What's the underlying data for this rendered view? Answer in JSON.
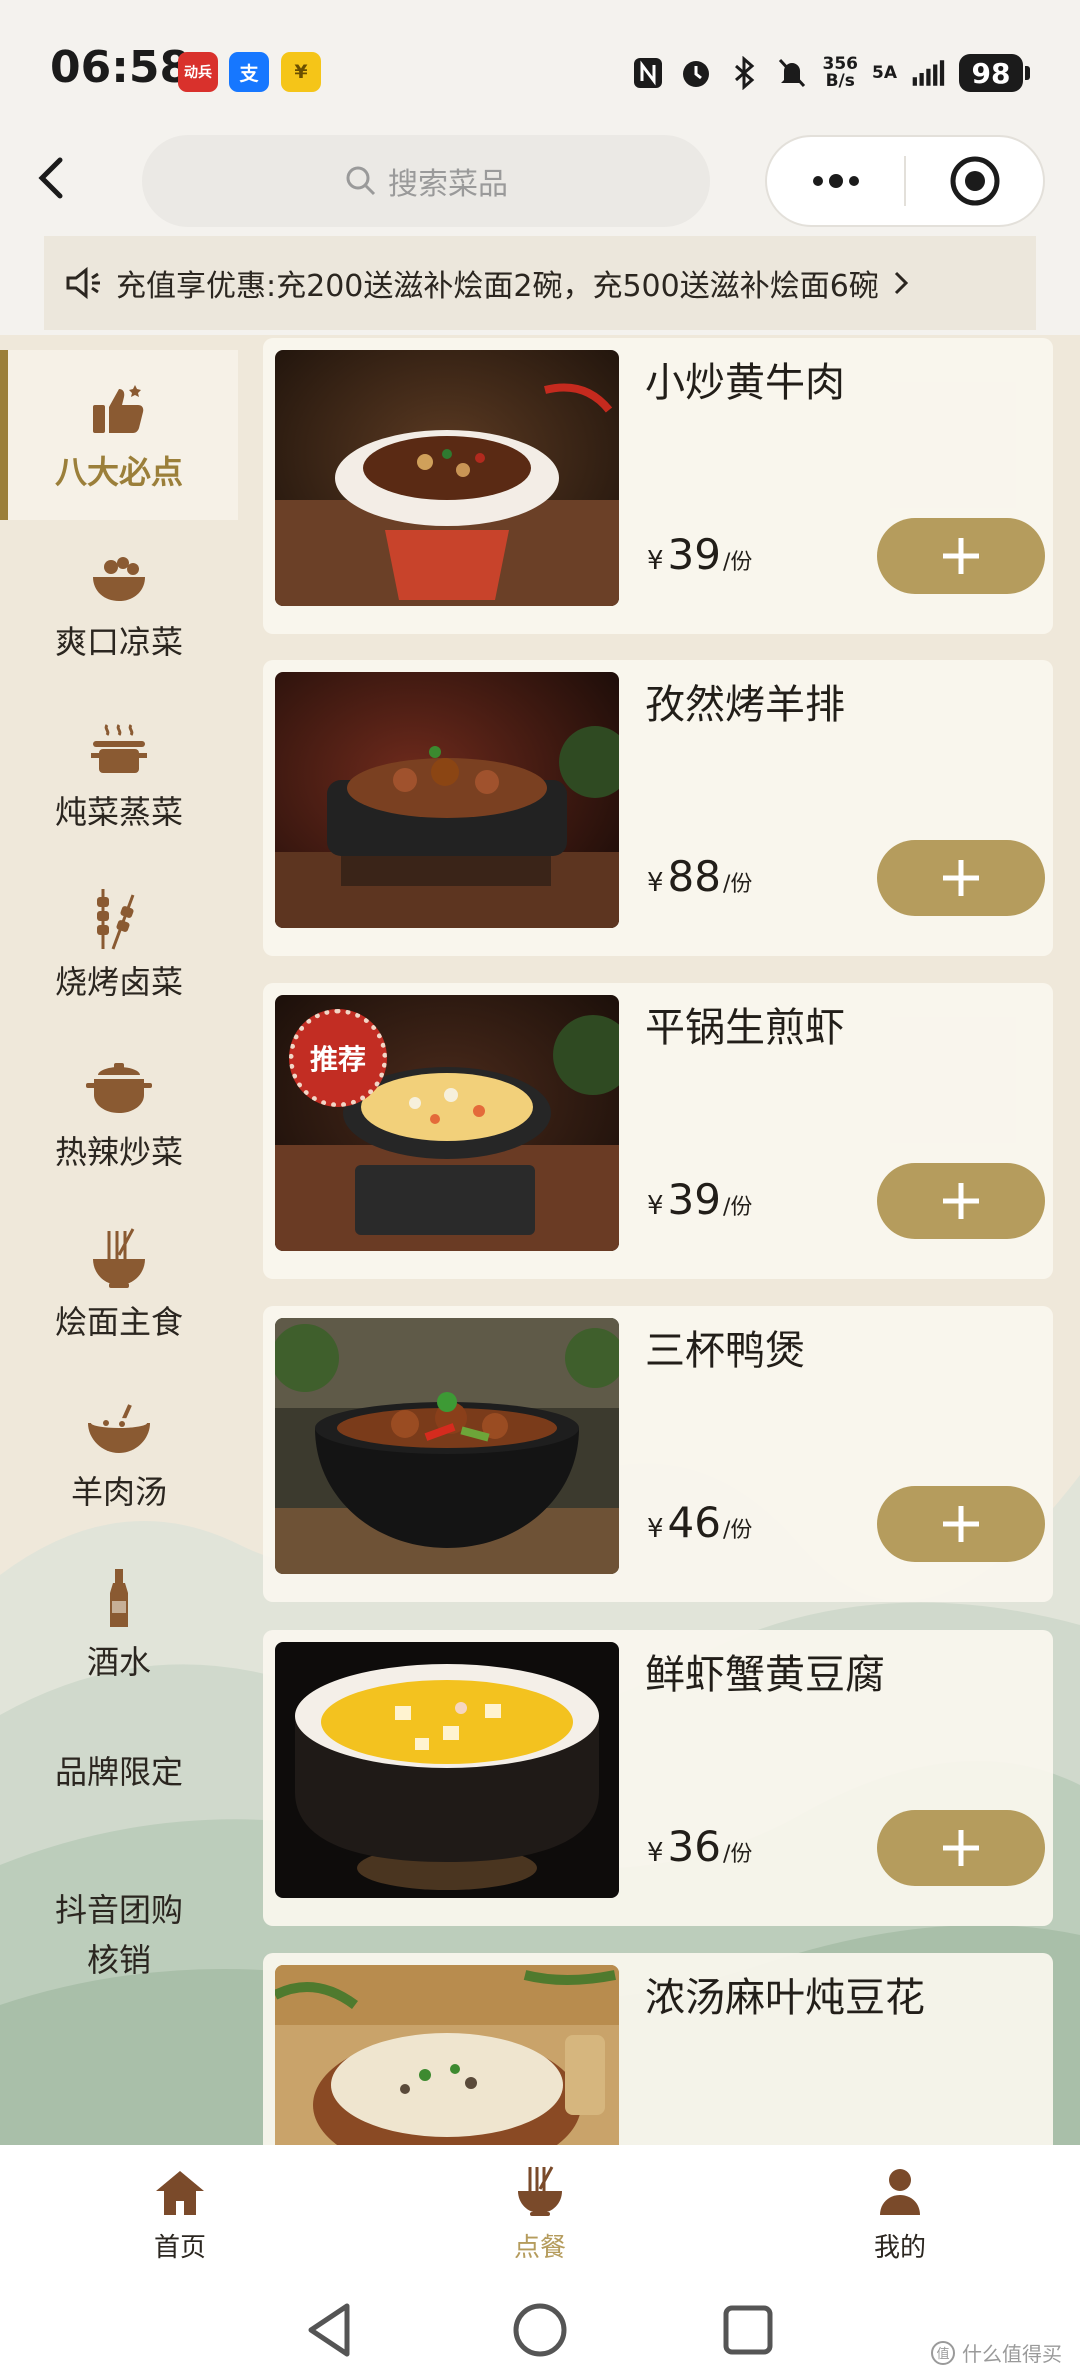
{
  "status_bar": {
    "time": "06:58",
    "app_badges": [
      "动兵",
      "支",
      "¥"
    ],
    "net_speed": "356",
    "net_unit": "B/s",
    "net_type": "5A",
    "battery": "98"
  },
  "header": {
    "search_placeholder": "搜索菜品"
  },
  "notice": {
    "text": "充值享优惠:充200送滋补烩面2碗，充500送滋补烩面6碗"
  },
  "sidebar": {
    "categories": [
      {
        "label": "八大必点",
        "icon": "thumbs-up-icon"
      },
      {
        "label": "爽口凉菜",
        "icon": "salad-bowl-icon"
      },
      {
        "label": "炖菜蒸菜",
        "icon": "steamer-pot-icon"
      },
      {
        "label": "烧烤卤菜",
        "icon": "skewer-icon"
      },
      {
        "label": "热辣炒菜",
        "icon": "cooking-pot-icon"
      },
      {
        "label": "烩面主食",
        "icon": "noodle-bowl-icon"
      },
      {
        "label": "羊肉汤",
        "icon": "soup-bowl-icon"
      },
      {
        "label": "酒水",
        "icon": "bottle-icon"
      },
      {
        "label": "品牌限定",
        "icon": ""
      },
      {
        "label": "抖音团购\n核销",
        "icon": ""
      }
    ]
  },
  "dishes": [
    {
      "name": "小炒黄牛肉",
      "currency": "¥",
      "price": "39",
      "unit": "/份",
      "tag": ""
    },
    {
      "name": "孜然烤羊排",
      "currency": "¥",
      "price": "88",
      "unit": "/份",
      "tag": ""
    },
    {
      "name": "平锅生煎虾",
      "currency": "¥",
      "price": "39",
      "unit": "/份",
      "tag": "推荐"
    },
    {
      "name": "三杯鸭煲",
      "currency": "¥",
      "price": "46",
      "unit": "/份",
      "tag": ""
    },
    {
      "name": "鲜虾蟹黄豆腐",
      "currency": "¥",
      "price": "36",
      "unit": "/份",
      "tag": ""
    },
    {
      "name": "浓汤麻叶炖豆花",
      "currency": "¥",
      "price": "",
      "unit": "",
      "tag": ""
    }
  ],
  "tabbar": {
    "tabs": [
      {
        "label": "首页",
        "icon": "home-icon",
        "active": false
      },
      {
        "label": "点餐",
        "icon": "noodle-bowl-icon",
        "active": true
      },
      {
        "label": "我的",
        "icon": "user-icon",
        "active": false
      }
    ]
  },
  "watermark": "什么值得买",
  "colors": {
    "accent": "#b59c5d",
    "active_text": "#9b7f3a",
    "icon_brown": "#8a5a32",
    "tag_red": "#c22d23"
  }
}
